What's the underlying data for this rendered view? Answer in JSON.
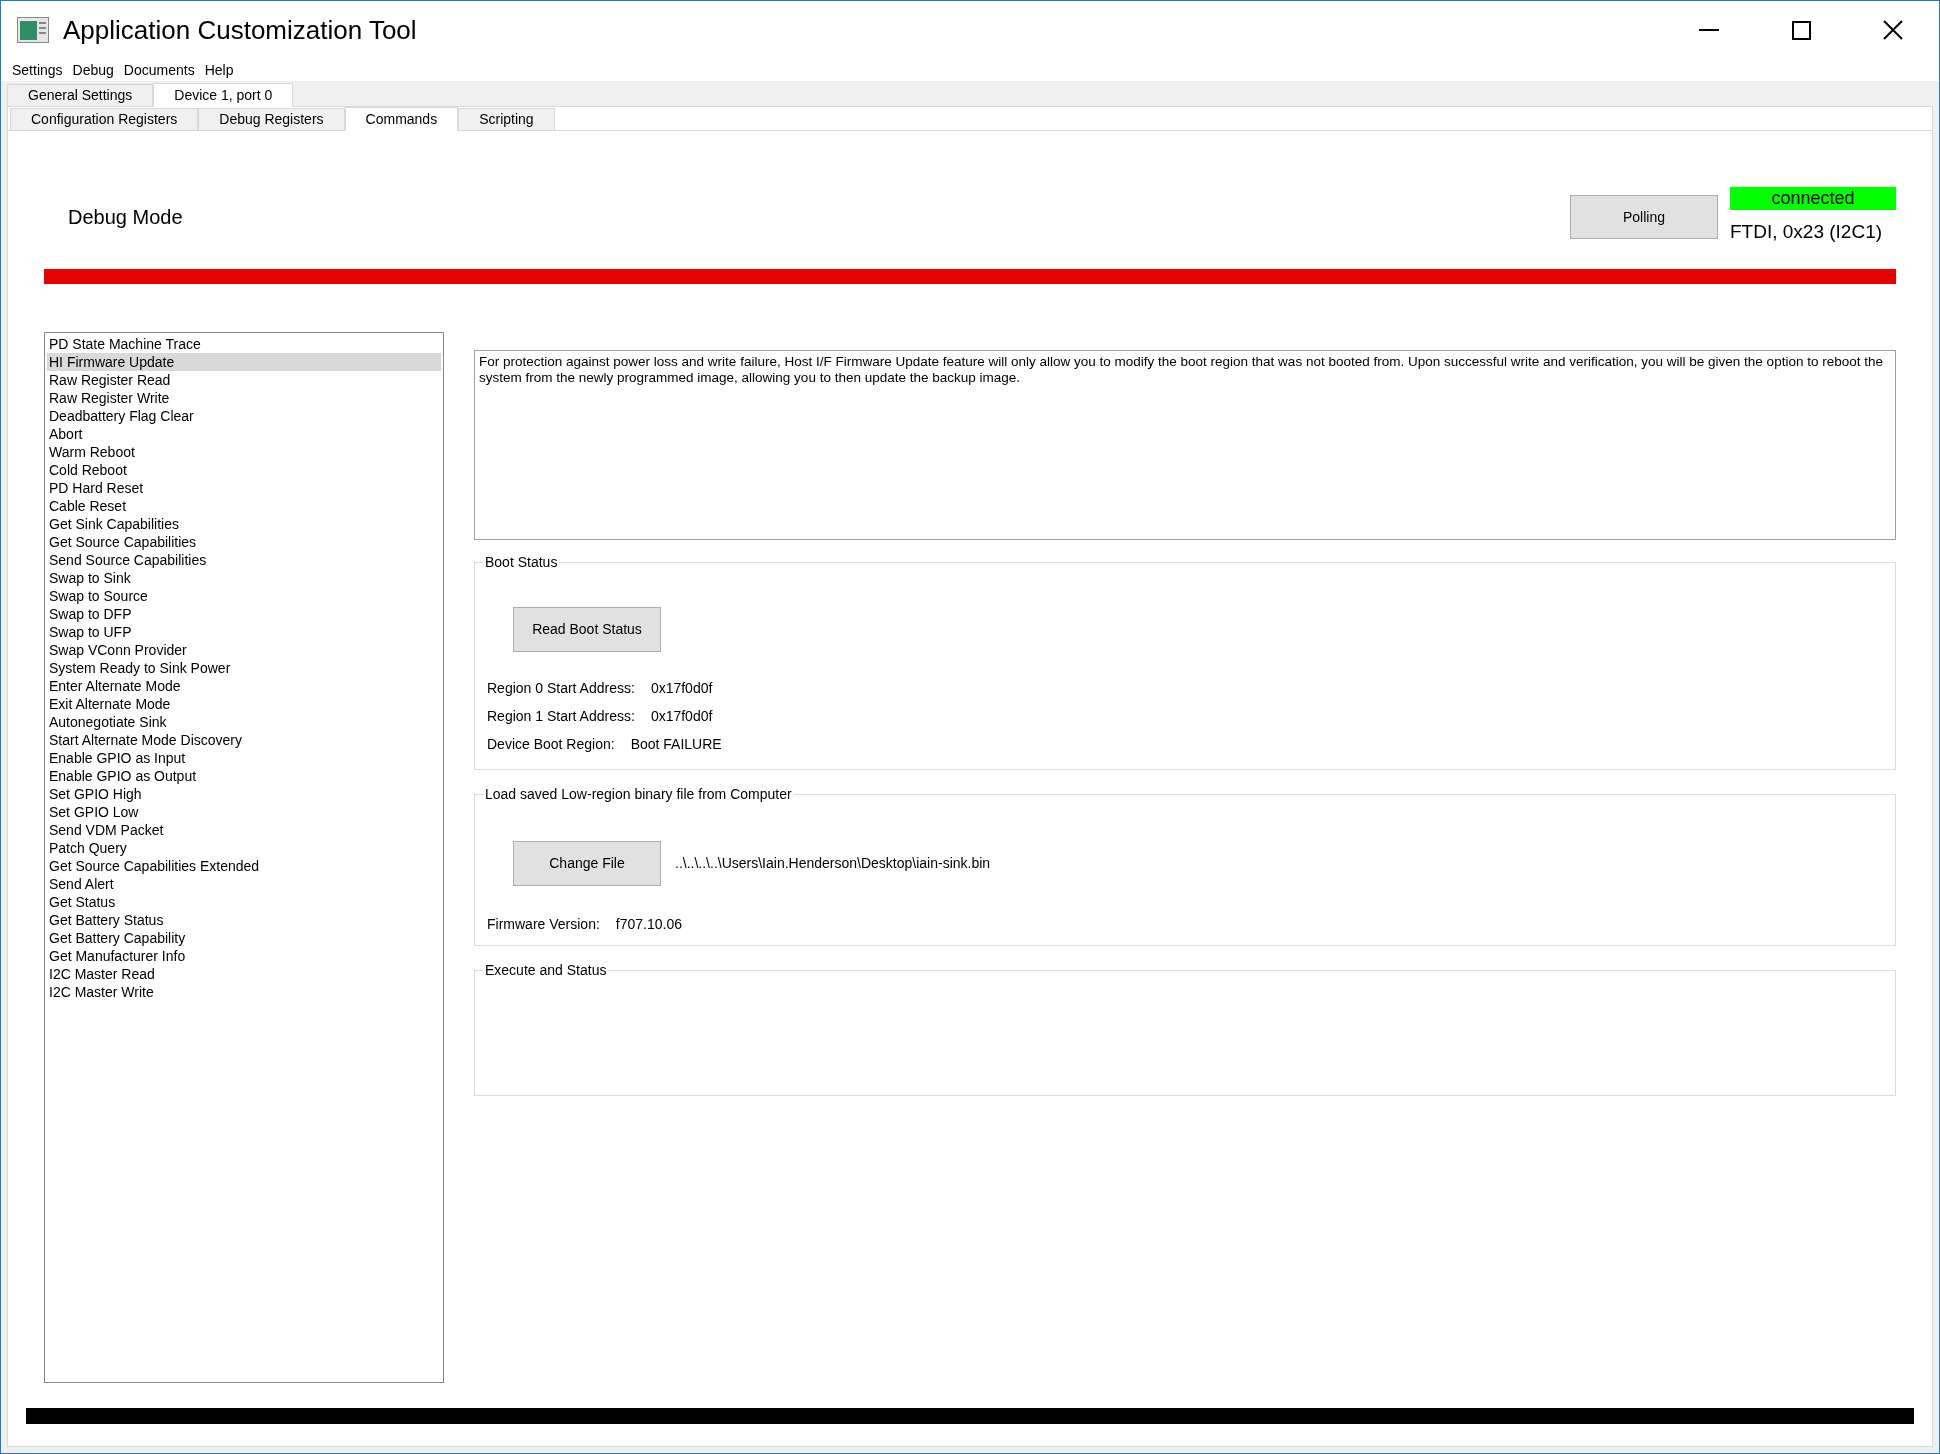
{
  "window": {
    "title": "Application Customization Tool"
  },
  "menu": [
    "Settings",
    "Debug",
    "Documents",
    "Help"
  ],
  "outer_tabs": [
    {
      "label": "General Settings",
      "selected": false
    },
    {
      "label": "Device 1, port 0",
      "selected": true
    }
  ],
  "inner_tabs": [
    {
      "label": "Configuration Registers",
      "selected": false
    },
    {
      "label": "Debug Registers",
      "selected": false
    },
    {
      "label": "Commands",
      "selected": true
    },
    {
      "label": "Scripting",
      "selected": false
    }
  ],
  "mode_label": "Debug Mode",
  "polling_button": "Polling",
  "connection": {
    "status": "connected",
    "device": "FTDI, 0x23 (I2C1)"
  },
  "commands": [
    {
      "label": "PD State Machine Trace",
      "selected": false
    },
    {
      "label": "HI Firmware Update",
      "selected": true
    },
    {
      "label": "Raw Register Read",
      "selected": false
    },
    {
      "label": "Raw Register Write",
      "selected": false
    },
    {
      "label": "Deadbattery Flag Clear",
      "selected": false
    },
    {
      "label": "Abort",
      "selected": false
    },
    {
      "label": "Warm Reboot",
      "selected": false
    },
    {
      "label": "Cold Reboot",
      "selected": false
    },
    {
      "label": "PD Hard Reset",
      "selected": false
    },
    {
      "label": "Cable Reset",
      "selected": false
    },
    {
      "label": "Get Sink Capabilities",
      "selected": false
    },
    {
      "label": "Get Source Capabilities",
      "selected": false
    },
    {
      "label": "Send Source Capabilities",
      "selected": false
    },
    {
      "label": "Swap to Sink",
      "selected": false
    },
    {
      "label": "Swap to Source",
      "selected": false
    },
    {
      "label": "Swap to DFP",
      "selected": false
    },
    {
      "label": "Swap to UFP",
      "selected": false
    },
    {
      "label": "Swap VConn Provider",
      "selected": false
    },
    {
      "label": "System Ready to Sink Power",
      "selected": false
    },
    {
      "label": "Enter Alternate Mode",
      "selected": false
    },
    {
      "label": "Exit Alternate Mode",
      "selected": false
    },
    {
      "label": "Autonegotiate Sink",
      "selected": false
    },
    {
      "label": "Start Alternate Mode Discovery",
      "selected": false
    },
    {
      "label": "Enable GPIO as Input",
      "selected": false
    },
    {
      "label": "Enable GPIO as Output",
      "selected": false
    },
    {
      "label": "Set GPIO High",
      "selected": false
    },
    {
      "label": "Set GPIO Low",
      "selected": false
    },
    {
      "label": "Send VDM Packet",
      "selected": false
    },
    {
      "label": "Patch Query",
      "selected": false
    },
    {
      "label": "Get Source Capabilities Extended",
      "selected": false
    },
    {
      "label": "Send Alert",
      "selected": false
    },
    {
      "label": "Get Status",
      "selected": false
    },
    {
      "label": "Get Battery Status",
      "selected": false
    },
    {
      "label": "Get Battery Capability",
      "selected": false
    },
    {
      "label": "Get Manufacturer Info",
      "selected": false
    },
    {
      "label": "I2C Master Read",
      "selected": false
    },
    {
      "label": "I2C Master Write",
      "selected": false
    }
  ],
  "description": "For protection against power loss and write failure, Host I/F Firmware Update feature will only allow you to modify the boot region that was not booted from. Upon successful write and verification, you will be given the option to reboot the system from the newly programmed image, allowing you to then update the backup image.",
  "boot_status": {
    "title": "Boot Status",
    "button": "Read Boot Status",
    "fields": [
      {
        "label": "Region 0 Start Address:",
        "value": "0x17f0d0f"
      },
      {
        "label": "Region 1 Start Address:",
        "value": "0x17f0d0f"
      },
      {
        "label": "Device Boot Region:",
        "value": "Boot FAILURE"
      }
    ]
  },
  "load_file": {
    "title": "Load saved Low-region binary file from Computer",
    "button": "Change File",
    "path": "..\\..\\..\\..\\Users\\Iain.Henderson\\Desktop\\iain-sink.bin",
    "fields": [
      {
        "label": "Firmware Version:",
        "value": "f707.10.06"
      }
    ]
  },
  "execute": {
    "title": "Execute and Status"
  }
}
